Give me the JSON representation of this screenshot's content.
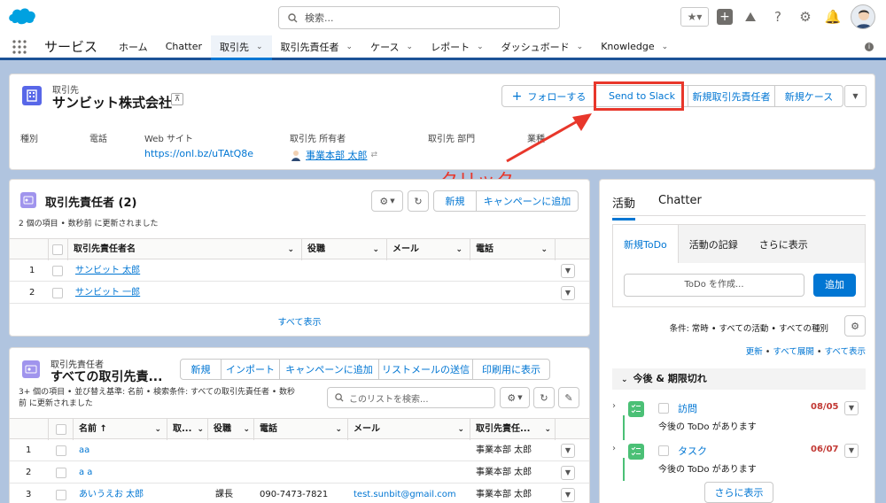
{
  "search": {
    "placeholder": "検索..."
  },
  "app": {
    "name": "サービス"
  },
  "nav": [
    {
      "label": "ホーム",
      "menu": false
    },
    {
      "label": "Chatter",
      "menu": false
    },
    {
      "label": "取引先",
      "menu": true,
      "active": true
    },
    {
      "label": "取引先責任者",
      "menu": true
    },
    {
      "label": "ケース",
      "menu": true
    },
    {
      "label": "レポート",
      "menu": true
    },
    {
      "label": "ダッシュボード",
      "menu": true
    },
    {
      "label": "Knowledge",
      "menu": true
    }
  ],
  "record": {
    "object": "取引先",
    "name": "サンビット株式会社",
    "buttons": {
      "follow": "フォローする",
      "slack": "Send to Slack",
      "new_contact": "新規取引先責任者",
      "new_case": "新規ケース"
    },
    "fields": [
      {
        "label": "種別",
        "value": ""
      },
      {
        "label": "電話",
        "value": ""
      },
      {
        "label": "Web サイト",
        "value": "https://onl.bz/uTAtQ8e"
      },
      {
        "label": "取引先 所有者",
        "value": "事業本部 太郎"
      },
      {
        "label": "取引先 部門",
        "value": ""
      },
      {
        "label": "業種",
        "value": ""
      }
    ]
  },
  "annotation": {
    "text": "クリック",
    "color": "#e8372b"
  },
  "contacts_related": {
    "title": "取引先責任者 (2)",
    "subtitle": "2 個の項目 • 数秒前 に更新されました",
    "buttons": {
      "new": "新規",
      "campaign": "キャンペーンに追加"
    },
    "columns": [
      "取引先責任者名",
      "役職",
      "メール",
      "電話"
    ],
    "rows": [
      {
        "num": "1",
        "name": "サンビット 太郎"
      },
      {
        "num": "2",
        "name": "サンビット 一郎"
      }
    ],
    "view_all": "すべて表示"
  },
  "contacts_list": {
    "object": "取引先責任者",
    "title": "すべての取引先責...",
    "subtitle1": "3+ 個の項目 • 並び替え基準: 名前 • 検索条件: すべての取引先責任者 • 数秒",
    "subtitle2": "前 に更新されました",
    "buttons": {
      "new": "新規",
      "import": "インポート",
      "campaign": "キャンペーンに追加",
      "listmail": "リストメールの送信",
      "print": "印刷用に表示"
    },
    "search_placeholder": "このリストを検索...",
    "columns": [
      "名前 ↑",
      "取...",
      "役職",
      "電話",
      "メール",
      "取引先責任..."
    ],
    "rows": [
      {
        "num": "1",
        "name": "aa",
        "title": "",
        "phone": "",
        "email": "",
        "owner": "事業本部 太郎"
      },
      {
        "num": "2",
        "name": "a a",
        "title": "",
        "phone": "",
        "email": "",
        "owner": "事業本部 太郎"
      },
      {
        "num": "3",
        "name": "あいうえお 太郎",
        "title": "課長",
        "phone": "090-7473-7821",
        "email": "test.sunbit@gmail.com",
        "owner": "事業本部 太郎"
      }
    ]
  },
  "activity": {
    "tabs": [
      "活動",
      "Chatter"
    ],
    "subtabs": [
      "新規ToDo",
      "活動の記録",
      "さらに表示"
    ],
    "todo_placeholder": "ToDo を作成...",
    "add": "追加",
    "filter": "条件: 常時 • すべての活動 • すべての種別",
    "links": {
      "refresh": "更新",
      "expand": "すべて展開",
      "all": "すべて表示"
    },
    "section": "今後 & 期限切れ",
    "tasks": [
      {
        "name": "訪問",
        "date": "08/05",
        "desc": "今後の ToDo があります"
      },
      {
        "name": "タスク",
        "date": "06/07",
        "desc": "今後の ToDo があります"
      }
    ],
    "more": "さらに表示",
    "date_color": "#c23934"
  }
}
